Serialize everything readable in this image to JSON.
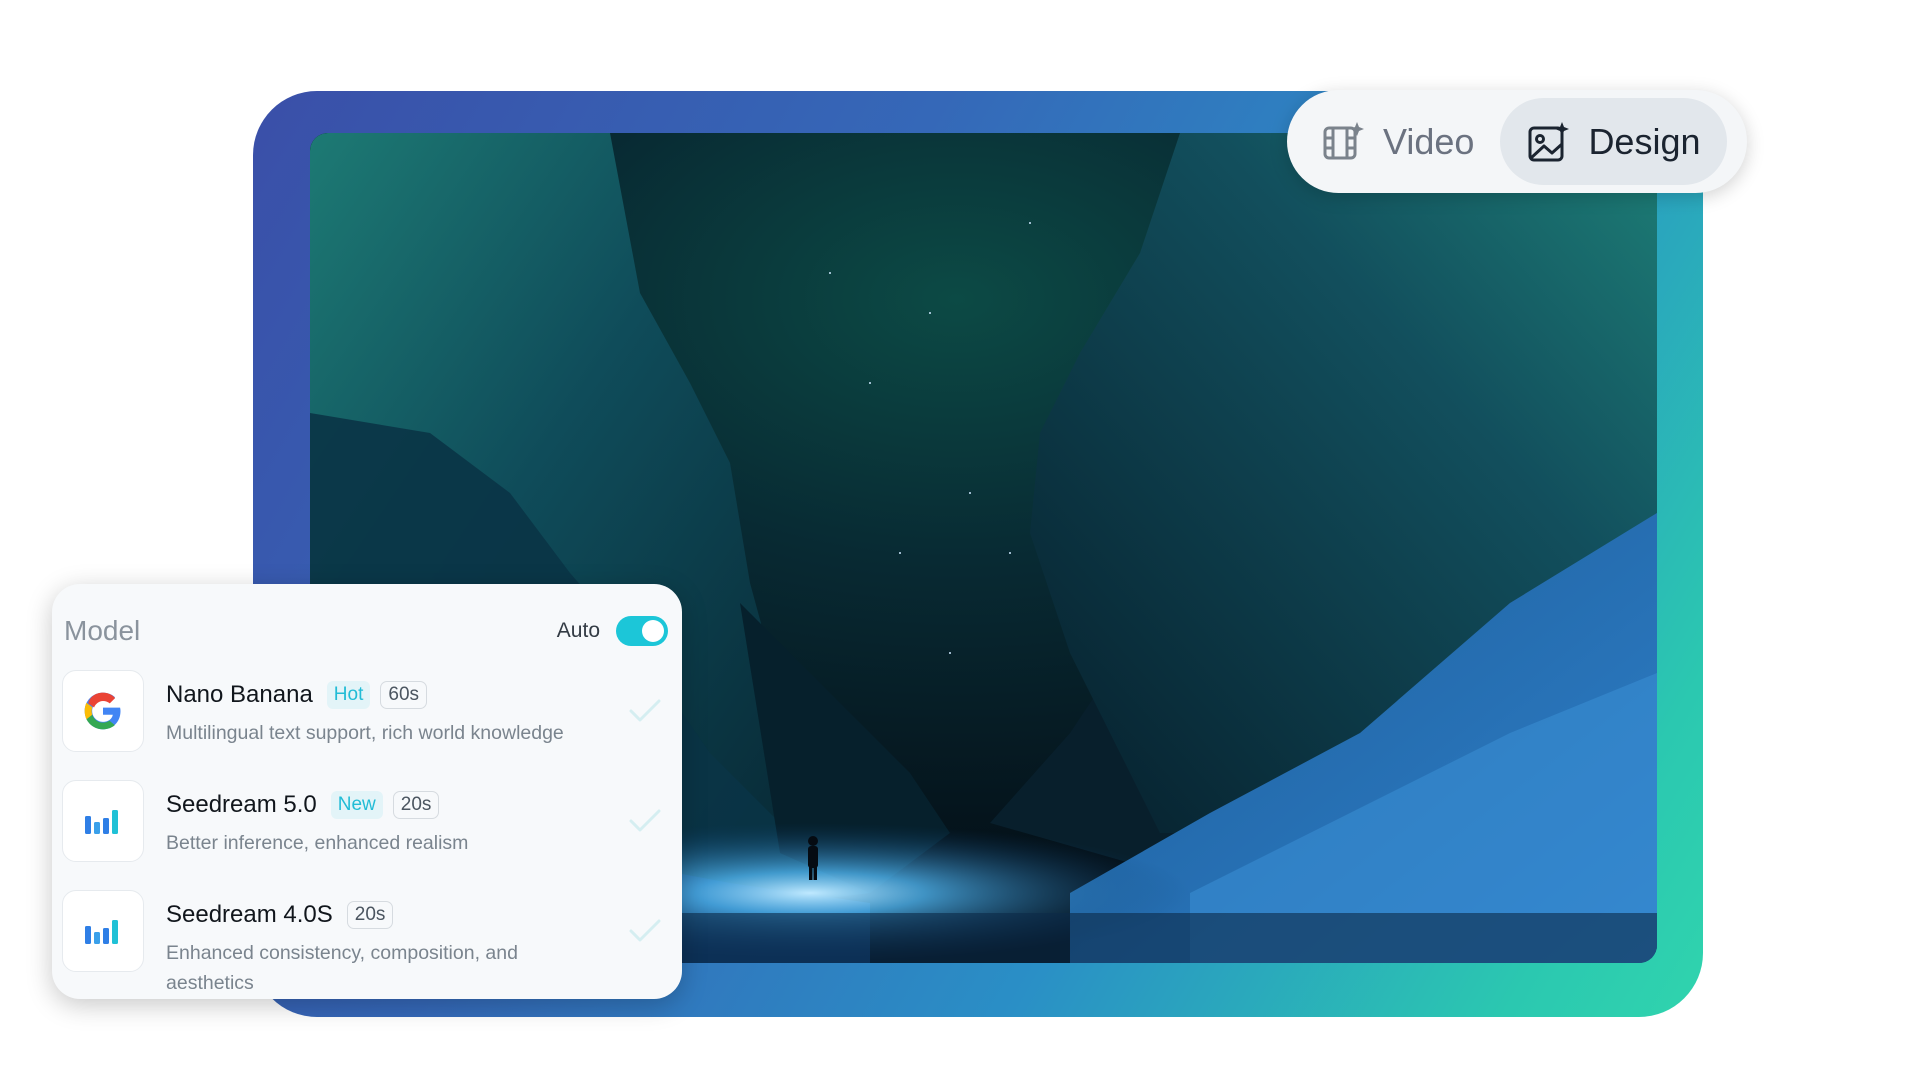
{
  "mode_switch": {
    "options": [
      {
        "label": "Video",
        "icon": "video-sparkle-icon",
        "active": false
      },
      {
        "label": "Design",
        "icon": "image-sparkle-icon",
        "active": true
      }
    ]
  },
  "model_panel": {
    "title": "Model",
    "auto_label": "Auto",
    "auto_enabled": true,
    "models": [
      {
        "name": "Nano Banana",
        "tag": "Hot",
        "time": "60s",
        "description": "Multilingual text support, rich world knowledge",
        "logo": "google-logo-icon"
      },
      {
        "name": "Seedream 5.0",
        "tag": "New",
        "time": "20s",
        "description": "Better inference, enhanced realism",
        "logo": "seedream-logo-icon"
      },
      {
        "name": "Seedream 4.0S",
        "tag": "",
        "time": "20s",
        "description": "Enhanced consistency, composition, and aesthetics",
        "logo": "seedream-logo-icon"
      }
    ]
  },
  "colors": {
    "accent": "#1cc6d8",
    "frame_start": "#3a4fa8",
    "frame_end": "#30d4ae"
  }
}
